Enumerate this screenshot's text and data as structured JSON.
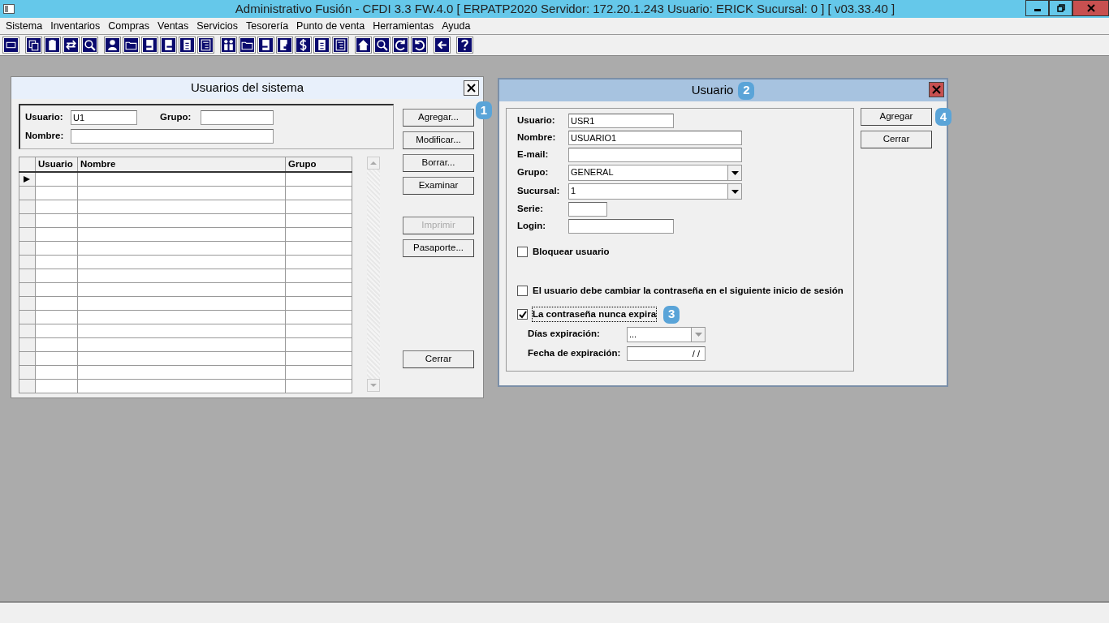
{
  "window": {
    "title": "Administrativo Fusión - CFDI 3.3 FW.4.0 [ ERPATP2020   Servidor: 172.20.1.243    Usuario: ERICK     Sucursal: 0 ] [ v03.33.40 ]"
  },
  "menu": [
    "Sistema",
    "Inventarios",
    "Compras",
    "Ventas",
    "Servicios",
    "Tesorería",
    "Punto de venta",
    "Herramientas",
    "Ayuda"
  ],
  "users_dialog": {
    "title": "Usuarios del sistema",
    "filters": [
      {
        "label": "Usuario:",
        "value": "U1"
      },
      {
        "label": "Grupo:"
      },
      {
        "label": "Nombre:"
      }
    ],
    "table": {
      "columns": [
        "Usuario",
        "Nombre",
        "Grupo"
      ],
      "rows": [
        {
          "current": true
        },
        {
          "current": false
        },
        {
          "current": false
        },
        {
          "current": false
        },
        {
          "current": false
        },
        {
          "current": false
        },
        {
          "current": false
        },
        {
          "current": false
        },
        {
          "current": false
        },
        {
          "current": false
        },
        {
          "current": false
        },
        {
          "current": false
        },
        {
          "current": false
        },
        {
          "current": false
        },
        {
          "current": false
        },
        {
          "current": false
        }
      ]
    },
    "buttons": [
      {
        "label": "Agregar...",
        "disabled": false,
        "callout": "1"
      },
      {
        "label": "Modificar...",
        "disabled": false
      },
      {
        "label": "Borrar...",
        "disabled": false
      },
      {
        "label": "Examinar",
        "disabled": false
      },
      {
        "label": "Imprimir",
        "disabled": true
      },
      {
        "label": "Pasaporte...",
        "disabled": false
      },
      {
        "label": "Cerrar",
        "disabled": false
      }
    ]
  },
  "user_dialog": {
    "title": "Usuario",
    "title_callout": "2",
    "fields": [
      {
        "kind": "text",
        "label": "Usuario:",
        "value": "USR1"
      },
      {
        "kind": "text",
        "label": "Nombre:",
        "value": "USUARIO1"
      },
      {
        "kind": "text",
        "label": "E-mail:"
      },
      {
        "kind": "combo",
        "label": "Grupo:",
        "value": "GENERAL"
      },
      {
        "kind": "combo",
        "label": "Sucursal:",
        "value": "1"
      },
      {
        "kind": "text",
        "label": "Serie:"
      },
      {
        "kind": "text",
        "label": "Login:"
      }
    ],
    "checkboxes": [
      {
        "label": "Bloquear usuario",
        "checked": false
      },
      {
        "label": "El usuario debe cambiar la contraseña en el siguiente inicio de sesión",
        "checked": false
      },
      {
        "label": "La contraseña nunca expira",
        "checked": true,
        "callout": "3"
      }
    ],
    "expiry": [
      {
        "kind": "combo",
        "label": "Días expiración:",
        "value": "..."
      },
      {
        "kind": "date",
        "label": "Fecha de expiración:",
        "value": "/ /"
      }
    ],
    "buttons": [
      {
        "label": "Agregar",
        "callout": "4"
      },
      {
        "label": "Cerrar"
      }
    ]
  }
}
